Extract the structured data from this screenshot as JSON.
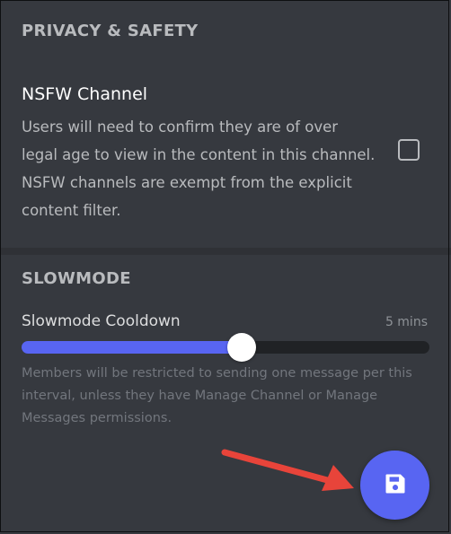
{
  "privacy": {
    "header": "PRIVACY & SAFETY",
    "nsfw_title": "NSFW Channel",
    "nsfw_description": "Users will need to confirm they are of over\nlegal age to view in the content in this channel.\nNSFW channels are exempt from the explicit\ncontent filter.",
    "nsfw_checked": false
  },
  "slowmode": {
    "header": "SLOWMODE",
    "cooldown_label": "Slowmode Cooldown",
    "cooldown_value": "5 mins",
    "slider_fraction": 0.54,
    "description": "Members will be restricted to sending one message per this interval, unless they have Manage Channel or Manage Messages permissions."
  },
  "save_button": {
    "icon": "save-icon"
  },
  "annotation": {
    "arrow_color": "#e8443a"
  },
  "colors": {
    "accent": "#5865f2",
    "background": "#36393f",
    "divider": "#2f3136"
  }
}
